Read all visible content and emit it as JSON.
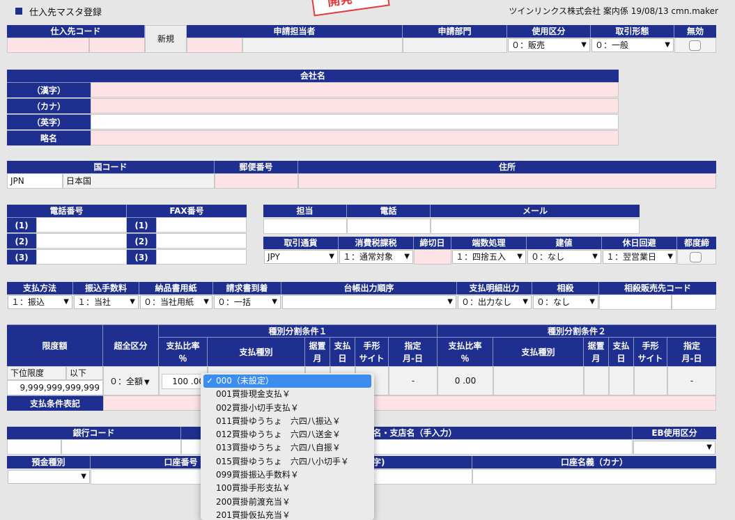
{
  "page": {
    "title": "仕入先マスタ登録",
    "header_info": "ツインリンクス株式会社 案内係 19/08/13 cmn.maker",
    "stamp": "開発"
  },
  "sec1": {
    "h_code": "仕入先コード",
    "new_button": "新規",
    "h_applicant": "申請担当者",
    "h_dept": "申請部門",
    "h_usage": "使用区分",
    "h_txtype": "取引形態",
    "h_invalid": "無効",
    "usage_value": "０：販売",
    "txtype_value": "０：一般"
  },
  "company": {
    "header": "会社名",
    "kanji": "（漢字）",
    "kana": "（カナ）",
    "eiji": "（英字）",
    "ryaku": "略名"
  },
  "addr": {
    "h_country": "国コード",
    "h_postal": "郵便番号",
    "h_address": "住所",
    "country_code": "JPN",
    "country_name": "日本国"
  },
  "phone": {
    "h_tel": "電話番号",
    "h_fax": "FAX番号",
    "r1": "(1)",
    "r2": "(2)",
    "r3": "(3)"
  },
  "contact": {
    "h_person": "担当",
    "h_tel": "電話",
    "h_mail": "メール"
  },
  "trade": {
    "h_currency": "取引通貨",
    "h_tax": "消費税課税",
    "h_closing": "締切日",
    "h_rounding": "端数処理",
    "h_price": "建値",
    "h_holiday": "休日回避",
    "h_each": "都度締",
    "currency": "JPY",
    "tax": "１：通常対象",
    "rounding": "１：四捨五入",
    "price": "０：なし",
    "holiday": "１：翌営業日"
  },
  "pay": {
    "h_method": "支払方法",
    "h_fee": "振込手数料",
    "h_delivery": "納品書用紙",
    "h_invoice": "請求書到着",
    "h_ledger": "台帳出力順序",
    "h_detail": "支払明細出力",
    "h_offset": "相殺",
    "h_offset_code": "相殺販売先コード",
    "method": "１：振込",
    "fee": "１：当社",
    "delivery": "０：当社用紙",
    "invoice": "０：一括",
    "detail": "０：出力なし",
    "offset": "０：なし"
  },
  "split": {
    "h_limit": "限度額",
    "h_over": "超全区分",
    "h_cond1": "種別分割条件１",
    "h_cond2": "種別分割条件２",
    "h_ratio": "支払比率",
    "h_ratio_unit": "％",
    "h_kind": "支払種別",
    "h_sueoki_1": "据置",
    "h_sueoki_2": "月",
    "h_shiharai_1": "支払",
    "h_shiharai_2": "日",
    "h_tegata_1": "手形",
    "h_tegata_2": "サイト",
    "h_shitei_1": "指定",
    "h_shitei_2": "月-日",
    "lower_limit": "下位限度",
    "below": "以下",
    "limit_value": "9,999,999,999,999",
    "over_value": "０：全額",
    "ratio1": "100 .00",
    "dash1": "-",
    "ratio2": "0 .00",
    "dash2": "-",
    "h_notation": "支払条件表記"
  },
  "bank": {
    "h_code": "銀行コード",
    "h_branch_name": "銀行名・支店名（手入力）",
    "h_eb": "EB使用区分",
    "h_deposit": "預金種別",
    "h_account": "口座番号",
    "h_holder_partial": "字)",
    "h_holder_kana": "口座名義（カナ）"
  },
  "dropdown": {
    "items": [
      "000（未設定）",
      "001買掛現金支払￥",
      "002買掛小切手支払￥",
      "011買掛ゆうちょ　六四八振込￥",
      "012買掛ゆうちょ　六四八送金￥",
      "013買掛ゆうちょ　六四八自振￥",
      "015買掛ゆうちょ　六四八小切手￥",
      "099買掛振込手数料￥",
      "100買掛手形支払￥",
      "200買掛前渡充当￥",
      "201買掛仮払充当￥"
    ],
    "selected_index": 0
  }
}
